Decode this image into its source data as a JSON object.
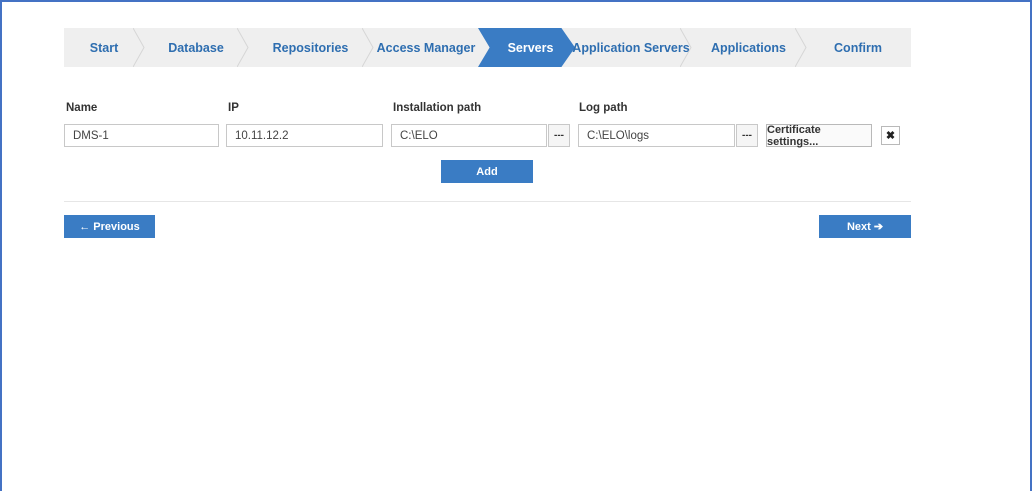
{
  "wizard": {
    "steps": [
      {
        "label": "Start"
      },
      {
        "label": "Database"
      },
      {
        "label": "Repositories"
      },
      {
        "label": "Access Manager"
      },
      {
        "label": "Servers"
      },
      {
        "label": "Application Servers"
      },
      {
        "label": "Applications"
      },
      {
        "label": "Confirm"
      }
    ],
    "active_step": "Servers"
  },
  "form": {
    "labels": {
      "name": "Name",
      "ip": "IP",
      "installation_path": "Installation path",
      "log_path": "Log path"
    },
    "servers": [
      {
        "name": "DMS-1",
        "ip": "10.11.12.2",
        "installation_path": "C:\\ELO",
        "log_path": "C:\\ELO\\logs"
      }
    ],
    "browse_label": "---",
    "certificate_button": "Certificate settings...",
    "remove_icon": "✖",
    "add_button": "Add"
  },
  "navigation": {
    "previous": "← Previous",
    "next": "Next ➔"
  },
  "colors": {
    "accent": "#3a7cc4",
    "step_bar": "#efefef",
    "step_text": "#2e6eb0"
  }
}
